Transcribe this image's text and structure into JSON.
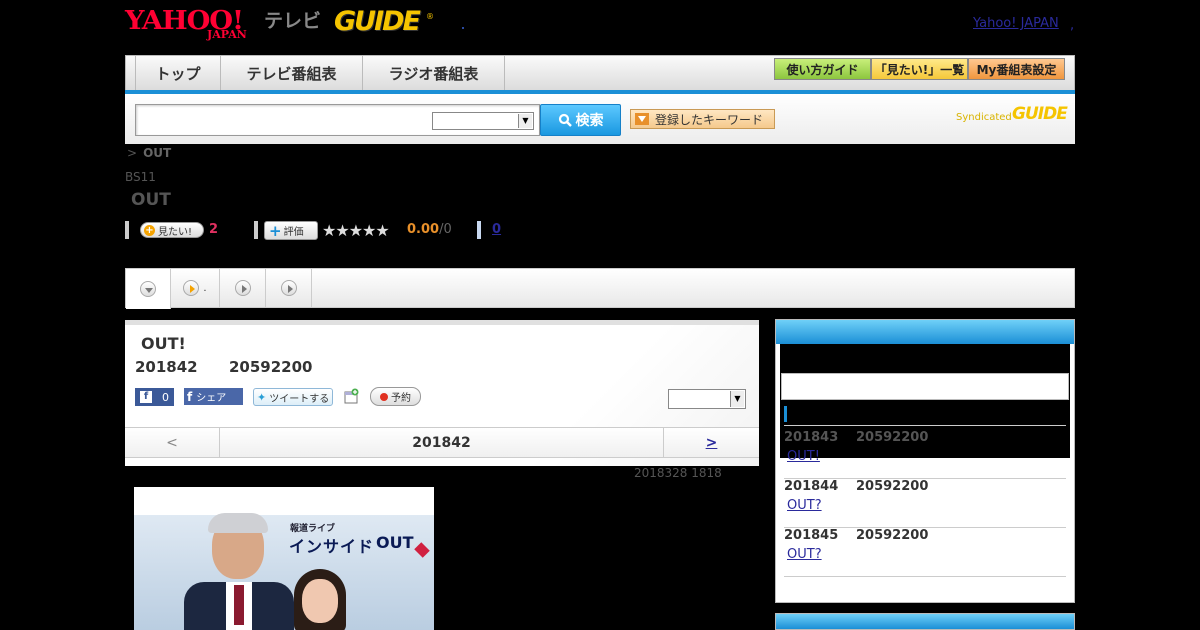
{
  "header": {
    "yahoo_logo": "YAHOO!",
    "yahoo_logo_sub": "JAPAN",
    "tv_label": "テレビ",
    "gguide_logo": "GUIDE",
    "yahoo_japan_link": "Yahoo! JAPAN",
    "link_separator": ","
  },
  "nav": {
    "tabs": [
      "トップ",
      "テレビ番組表",
      "ラジオ番組表"
    ],
    "buttons": [
      "使い方ガイド",
      "「見たい!」一覧",
      "My番組表設定"
    ],
    "button_colors": [
      "#9bd24a",
      "#ffd24a",
      "#f5a35a"
    ]
  },
  "search": {
    "input_value": "",
    "select_value": "",
    "search_button": "検索",
    "keyword_button": "登録したキーワード",
    "syndicated": "Syndicated",
    "syndicated_logo": "GUIDE"
  },
  "program": {
    "breadcrumb_sep": ">",
    "breadcrumb_current": "OUT",
    "channel": "BS11",
    "title": "OUT",
    "mitai_label": "見たい!",
    "mitai_count": "2",
    "hyoka_label": "評価",
    "stars": "★★★★★",
    "score": "0.00",
    "score_count": "/0",
    "comment_count": "0"
  },
  "tabs": [
    {
      "icon": "down",
      "label": ""
    },
    {
      "icon": "right-orange",
      "label": "."
    },
    {
      "icon": "right",
      "label": ""
    },
    {
      "icon": "right",
      "label": ""
    }
  ],
  "episode": {
    "title": "OUT!",
    "date": "201842",
    "time": "20592200",
    "fb_like_count": "0",
    "fb_share": "シェア",
    "tweet": "ツイートする",
    "reserve": "予約",
    "select_value": "",
    "pager_prev": "<",
    "pager_current": "201842",
    "pager_next": ">",
    "updated": "2018328  1818"
  },
  "thumbnail": {
    "subtitle": "報道ライブ",
    "name": "インサイド",
    "name_out": "OUT"
  },
  "side": {
    "items": [
      {
        "date": "201843",
        "time": "20592200",
        "link": "OUT!"
      },
      {
        "date": "201844",
        "time": "20592200",
        "link": "OUT?"
      },
      {
        "date": "201845",
        "time": "20592200",
        "link": "OUT?"
      }
    ]
  }
}
